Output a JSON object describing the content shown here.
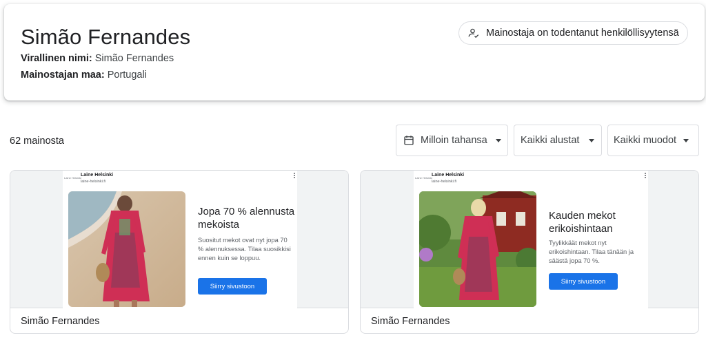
{
  "advertiser": {
    "name": "Simão Fernandes",
    "official_name_label": "Virallinen nimi:",
    "official_name_value": "Simão Fernandes",
    "country_label": "Mainostajan maa:",
    "country_value": "Portugali",
    "verified_label": "Mainostaja on todentanut henkilöllisyytensä",
    "verified_icon": "person-check-icon"
  },
  "results": {
    "count_label": "62 mainosta"
  },
  "filters": {
    "date": {
      "label": "Milloin tahansa",
      "icon": "calendar-icon"
    },
    "platform": {
      "label": "Kaikki alustat"
    },
    "format": {
      "label": "Kaikki muodot"
    }
  },
  "ads": [
    {
      "site_name": "Laine Helsinki",
      "site_url": "laine-helsinki.fi",
      "site_logo": "Laine Helsinki",
      "headline": "Jopa 70 % alennusta mekoista",
      "body": "Suositut mekot ovat nyt jopa 70 % alennuksessa. Tilaa suosikkisi ennen kuin se loppuu.",
      "cta": "Siirry sivustoon",
      "advertiser": "Simão Fernandes"
    },
    {
      "site_name": "Laine Helsinki",
      "site_url": "laine-helsinki.fi",
      "site_logo": "Laine Helsinki",
      "headline": "Kauden mekot erikoishintaan",
      "body": "Tyylikkäät mekot nyt erikoishintaan. Tilaa tänään ja säästä jopa 70 %.",
      "cta": "Siirry sivustoon",
      "advertiser": "Simão Fernandes"
    }
  ],
  "colors": {
    "accent": "#1a73e8",
    "border": "#dadce0",
    "preview_bg": "#f1f3f4"
  }
}
